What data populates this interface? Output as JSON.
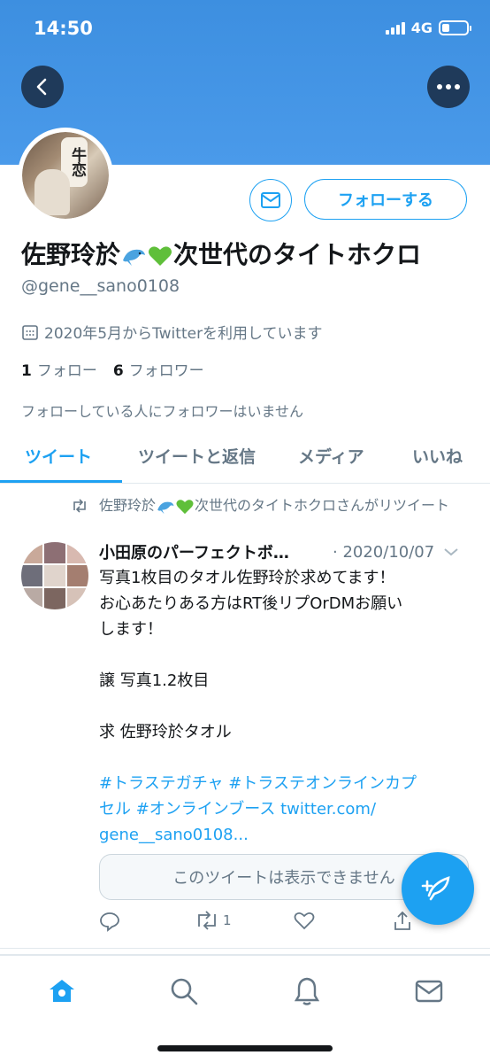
{
  "status_bar": {
    "time": "14:50",
    "network": "4G",
    "battery_level": 0.3
  },
  "profile": {
    "display_name": "佐野玲於",
    "display_name_suffix": "次世代のタイトホクロ",
    "handle": "@gene__sano0108",
    "joined": "2020年5月からTwitterを利用しています",
    "following_count": "1",
    "following_label": "フォロー",
    "followers_count": "6",
    "followers_label": "フォロワー",
    "no_followers_you_know": "フォローしている人にフォロワーはいません",
    "follow_button": "フォローする",
    "avatar_sign_text": "牛恋"
  },
  "tabs": [
    {
      "label": "ツイート",
      "active": true
    },
    {
      "label": "ツイートと返信",
      "active": false
    },
    {
      "label": "メディア",
      "active": false
    },
    {
      "label": "いいね",
      "active": false
    }
  ],
  "tweet": {
    "retweet_prefix": "佐野玲於",
    "retweet_suffix": "次世代のタイトホクロさんがリツイート",
    "author": "小田原のパーフェクトボ…",
    "date": "· 2020/10/07",
    "lines": [
      "写真1枚目のタオル佐野玲於求めてます！",
      "お心あたりある方はRT後リプOrDMお願い",
      "します！",
      "",
      "譲 写真1.2枚目",
      "",
      "求 佐野玲於タオル",
      ""
    ],
    "hashtags_line1": "#トラステガチャ #トラステオンラインカプ",
    "hashtags_line2": "セル #オンラインブース twitter.com/",
    "hashtags_line3": "gene__sano0108...",
    "unavailable_text": "このツイートは表示できません",
    "retweet_count": "1"
  },
  "colors": {
    "accent": "#1da1f2",
    "banner": "#4a9aea",
    "text_secondary": "#657786"
  }
}
